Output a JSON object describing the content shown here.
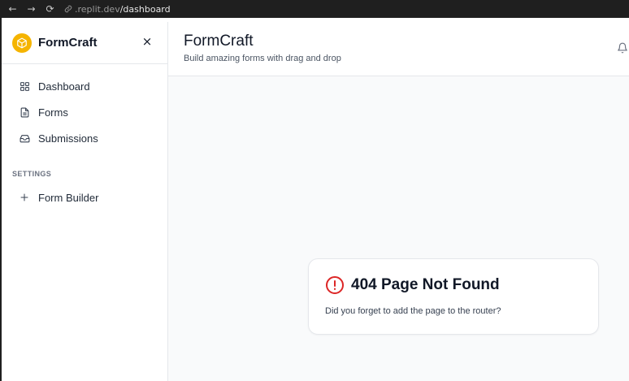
{
  "browser": {
    "back_icon": "←",
    "forward_icon": "→",
    "reload_icon": "⟳",
    "url_domain": ".replit.dev",
    "url_path": "/dashboard"
  },
  "sidebar": {
    "brand": "FormCraft",
    "close_icon": "×",
    "items": [
      {
        "label": "Dashboard",
        "icon": "grid-icon"
      },
      {
        "label": "Forms",
        "icon": "file-icon"
      },
      {
        "label": "Submissions",
        "icon": "inbox-icon"
      }
    ],
    "settings_title": "SETTINGS",
    "settings_items": [
      {
        "label": "Form Builder",
        "icon": "plus-icon"
      }
    ]
  },
  "header": {
    "title": "FormCraft",
    "subtitle": "Build amazing forms with drag and drop"
  },
  "error": {
    "title": "404 Page Not Found",
    "message": "Did you forget to add the page to the router?"
  },
  "colors": {
    "brand": "#f5b400",
    "error": "#dc2626",
    "text": "#111827",
    "border": "#e5e7eb",
    "main_bg": "#f9fafb"
  }
}
